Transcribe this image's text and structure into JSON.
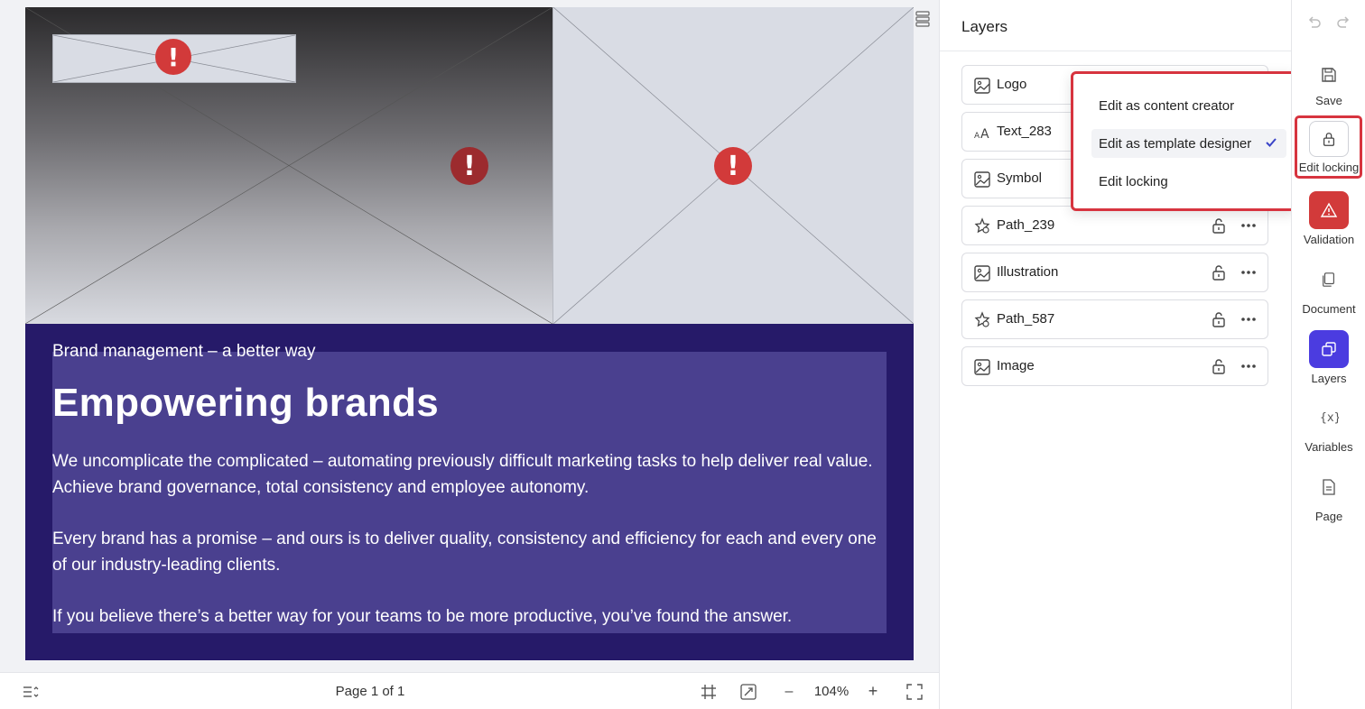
{
  "canvas": {
    "logo_frame_error": "!",
    "hero_error": "!",
    "side_error": "!",
    "eyebrow": "Brand management – a better way",
    "headline": "Empowering brands",
    "paragraph1": "We uncomplicate the complicated – automating previously difficult marketing tasks to help deliver real value. Achieve brand governance, total consistency and employee autonomy.",
    "paragraph2": "Every brand has a promise – and ours is to deliver quality, consistency and efficiency for each and every one of our industry-leading clients.",
    "paragraph3": "If you believe there’s a better way for your teams to be more productive, you’ve found the answer."
  },
  "bottom_bar": {
    "page_indicator": "Page 1 of 1",
    "zoom_out": "–",
    "zoom_level": "104%",
    "zoom_in": "+"
  },
  "layers_panel": {
    "title": "Layers",
    "items": [
      {
        "label": "Logo",
        "icon": "image-icon"
      },
      {
        "label": "Text_283",
        "icon": "text-icon"
      },
      {
        "label": "Symbol",
        "icon": "image-icon"
      },
      {
        "label": "Path_239",
        "icon": "shape-icon"
      },
      {
        "label": "Illustration",
        "icon": "image-icon"
      },
      {
        "label": "Path_587",
        "icon": "shape-icon"
      },
      {
        "label": "Image",
        "icon": "image-icon"
      }
    ]
  },
  "edit_menu": {
    "items": [
      {
        "label": "Edit as content creator",
        "selected": false
      },
      {
        "label": "Edit as template designer",
        "selected": true
      },
      {
        "label": "Edit locking",
        "selected": false
      }
    ]
  },
  "right_rail": {
    "save": "Save",
    "edit_locking": "Edit locking",
    "validation": "Validation",
    "document": "Document",
    "layers": "Layers",
    "variables": "Variables",
    "page": "Page"
  },
  "colors": {
    "accent": "#4b3ce0",
    "error": "#d23a3a",
    "content_block": "#261a69",
    "highlight": "#d7343f"
  }
}
